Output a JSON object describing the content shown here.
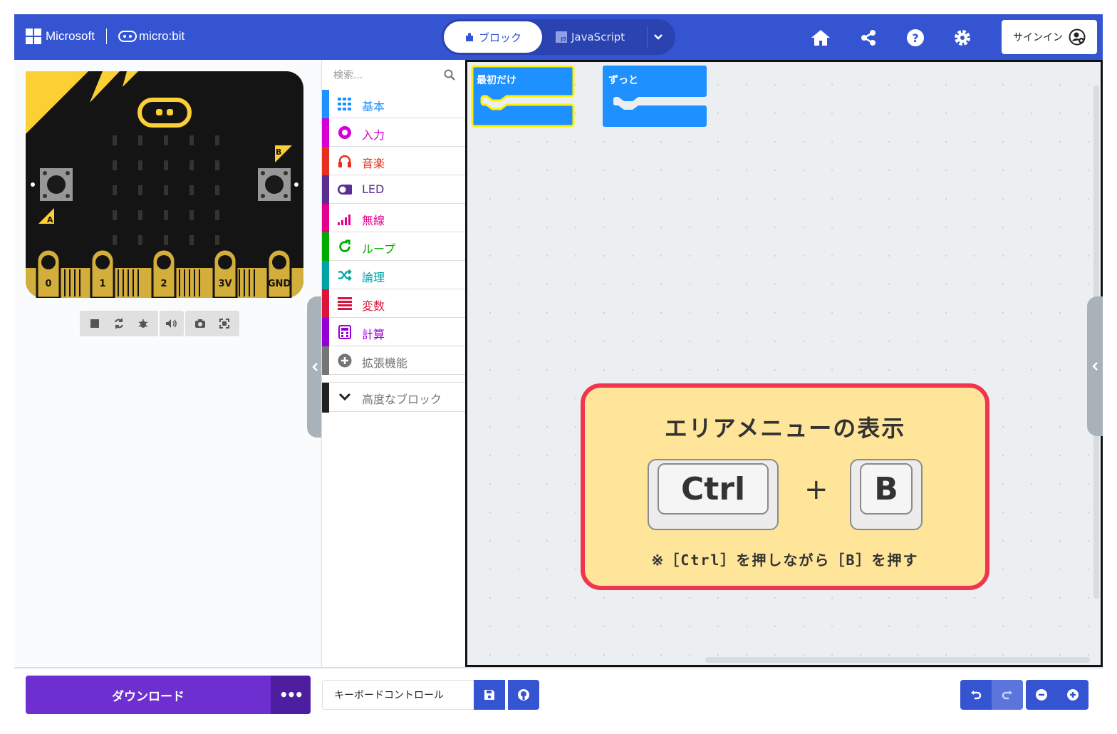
{
  "header": {
    "brand": "Microsoft",
    "product": "micro:bit",
    "tab_blocks": "ブロック",
    "tab_javascript": "JavaScript",
    "js_badge": "JS",
    "signin": "サインイン"
  },
  "toolbox": {
    "search_placeholder": "検索...",
    "categories": [
      {
        "label": "基本",
        "color": "#1e90ff",
        "icon": "grid-icon"
      },
      {
        "label": "入力",
        "color": "#d400d4",
        "icon": "radio-dot-icon"
      },
      {
        "label": "音楽",
        "color": "#e63022",
        "icon": "headphones-icon"
      },
      {
        "label": "LED",
        "color": "#5c2d91",
        "icon": "toggle-icon"
      },
      {
        "label": "無線",
        "color": "#e3008c",
        "icon": "signal-icon"
      },
      {
        "label": "ループ",
        "color": "#00aa00",
        "icon": "loop-icon"
      },
      {
        "label": "論理",
        "color": "#00a4a6",
        "icon": "shuffle-icon"
      },
      {
        "label": "変数",
        "color": "#dc143c",
        "icon": "list-icon"
      },
      {
        "label": "計算",
        "color": "#9400d3",
        "icon": "calculator-icon"
      },
      {
        "label": "拡張機能",
        "color": "#757575",
        "icon": "plus-circle-icon"
      }
    ],
    "advanced": {
      "label": "高度なブロック",
      "color": "#212121"
    }
  },
  "board": {
    "button_a": "A",
    "button_b": "B",
    "pins": [
      "0",
      "1",
      "2",
      "3V",
      "GND"
    ]
  },
  "workspace": {
    "block_on_start": "最初だけ",
    "block_forever": "ずっと"
  },
  "callout": {
    "title": "エリアメニューの表示",
    "key1": "Ctrl",
    "plus": "+",
    "key2": "B",
    "note": "※［Ctrl］を押しながら［B］を押す"
  },
  "footer": {
    "download": "ダウンロード",
    "more": "•••",
    "project_name": "キーボードコントロール"
  },
  "colors": {
    "header": "#3454d1",
    "download": "#6d2fcf",
    "callout_border": "#f0354f",
    "callout_bg": "#ffe599"
  }
}
